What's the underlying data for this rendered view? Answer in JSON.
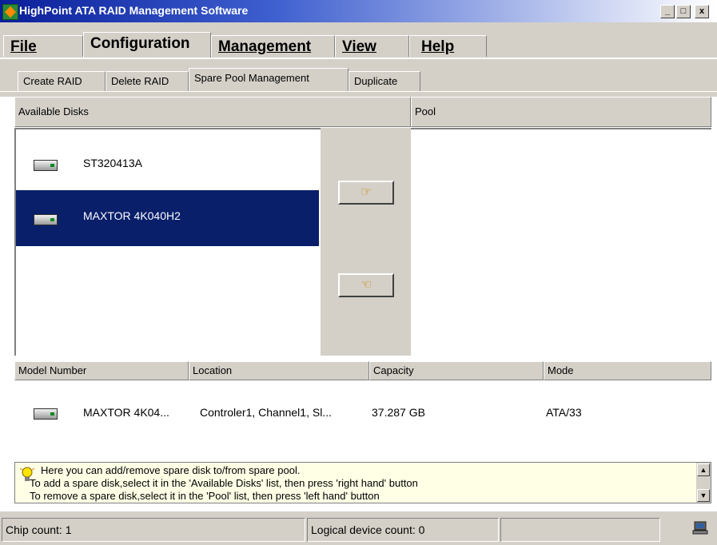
{
  "window": {
    "title": "HighPoint ATA RAID Management Software",
    "minimize": "_",
    "maximize": "□",
    "close": "x"
  },
  "menu": {
    "file": "File",
    "configuration": "Configuration",
    "management": "Management",
    "view": "View",
    "help": "Help"
  },
  "subtabs": {
    "create_raid": "Create RAID",
    "delete_raid": "Delete RAID",
    "spare_pool": "Spare Pool Management",
    "duplicate": "Duplicate"
  },
  "panes": {
    "available_header": "Available Disks",
    "pool_header": "Pool"
  },
  "available_disks": [
    {
      "name": "ST320413A",
      "selected": false
    },
    {
      "name": "MAXTOR 4K040H2",
      "selected": true
    }
  ],
  "buttons": {
    "add_icon": "right-hand-icon",
    "remove_icon": "left-hand-icon"
  },
  "details": {
    "headers": [
      "Model Number",
      "Location",
      "Capacity",
      "Mode"
    ],
    "row": {
      "model": "MAXTOR 4K04...",
      "location": "Controler1, Channel1, Sl...",
      "capacity": "37.287 GB",
      "mode": "ATA/33"
    }
  },
  "help": {
    "lines": [
      "Here you can add/remove spare disk to/from spare pool.",
      "To add a spare disk,select it in the 'Available Disks' list, then press 'right hand' button",
      "To remove a spare disk,select it in the 'Pool' list, then press 'left hand' button"
    ]
  },
  "status": {
    "chip_count": "Chip count: 1",
    "logical_device_count": "Logical device count: 0"
  },
  "colors": {
    "selection": "#0a1f6a",
    "face": "#d4d0c8",
    "help_bg": "#ffffe6"
  }
}
